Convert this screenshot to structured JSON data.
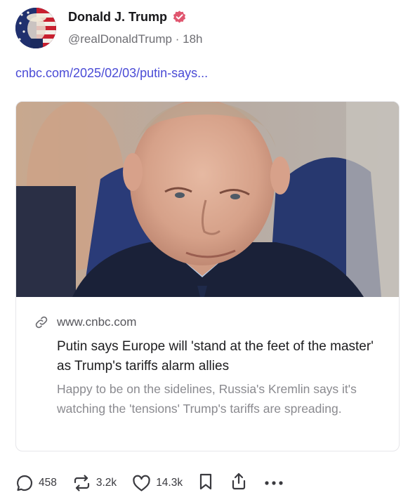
{
  "author": {
    "display_name": "Donald J. Trump",
    "handle": "@realDonaldTrump",
    "separator": "·",
    "time_ago": "18h",
    "verified": true,
    "badge_color": "#e0566f"
  },
  "post": {
    "link_text": "cnbc.com/2025/02/03/putin-says..."
  },
  "link_card": {
    "domain": "www.cnbc.com",
    "headline": "Putin says Europe will 'stand at the feet of the master' as Trump's tariffs alarm allies",
    "description": "Happy to be on the sidelines, Russia's Kremlin says it's watching the 'tensions' Trump's tariffs are spreading."
  },
  "actions": {
    "replies": "458",
    "reposts": "3.2k",
    "likes": "14.3k",
    "bookmark_icon": "bookmark-icon",
    "share_icon": "share-icon",
    "more_icon": "more-icon"
  },
  "colors": {
    "link": "#4a4bd6",
    "muted_text": "#6e6e73",
    "description_text": "#8a8a8f"
  }
}
